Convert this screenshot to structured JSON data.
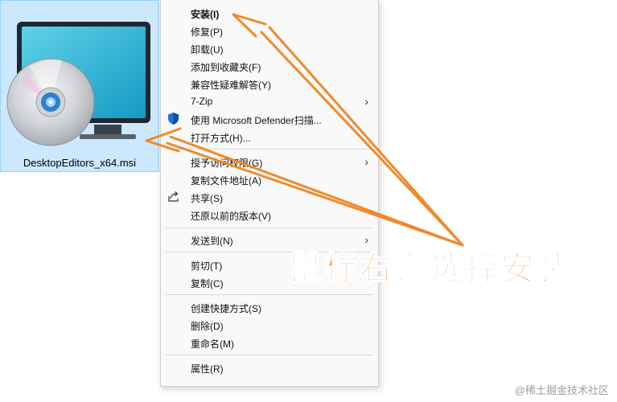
{
  "file": {
    "name": "DesktopEditors_x64.msi",
    "icon": "msi-installer-icon"
  },
  "context_menu": {
    "items": [
      {
        "label": "安装(I)",
        "bold": true
      },
      {
        "label": "修复(P)"
      },
      {
        "label": "卸载(U)"
      },
      {
        "label": "添加到收藏夹(F)"
      },
      {
        "label": "兼容性疑难解答(Y)"
      },
      {
        "label": "7-Zip",
        "submenu": true
      },
      {
        "label": "使用 Microsoft Defender扫描...",
        "icon": "shield-icon"
      },
      {
        "label": "打开方式(H)..."
      },
      {
        "label": "授予访问权限(G)",
        "submenu": true
      },
      {
        "label": "复制文件地址(A)"
      },
      {
        "label": "共享(S)",
        "icon": "share-icon"
      },
      {
        "label": "还原以前的版本(V)"
      },
      {
        "label": "发送到(N)",
        "submenu": true
      },
      {
        "label": "剪切(T)"
      },
      {
        "label": "复制(C)"
      },
      {
        "label": "创建快捷方式(S)"
      },
      {
        "label": "删除(D)"
      },
      {
        "label": "重命名(M)"
      },
      {
        "label": "属性(R)"
      }
    ],
    "submenu_glyph": "›"
  },
  "annotation": {
    "text": "鼠标右键选择安装",
    "color": "#f08a2c"
  },
  "watermark": "@稀土掘金技术社区"
}
